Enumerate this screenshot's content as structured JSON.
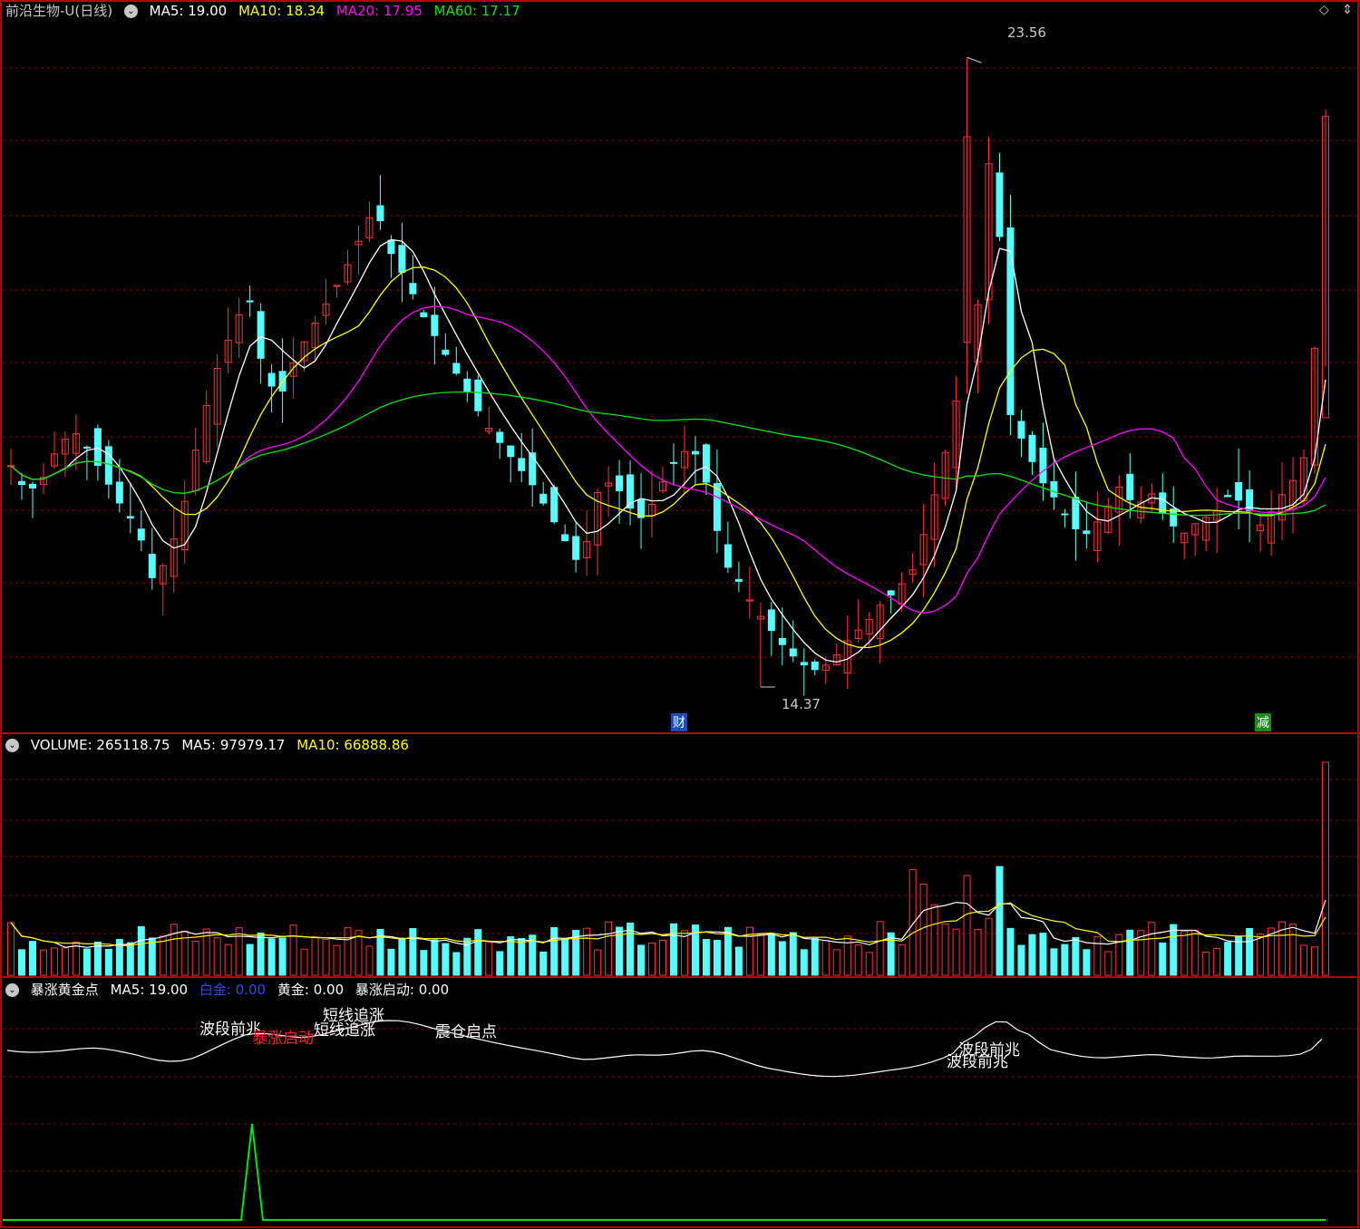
{
  "header": {
    "title": "前沿生物-U(日线)",
    "ma5": "MA5: 19.00",
    "ma10": "MA10: 18.34",
    "ma20": "MA20: 17.95",
    "ma60": "MA60: 17.17",
    "window_icons": [
      "◇",
      "⇕"
    ]
  },
  "volume_header": {
    "volume": "VOLUME: 265118.75",
    "ma5": "MA5: 97979.17",
    "ma10": "MA10: 66888.86"
  },
  "indicator_header": {
    "name": "暴涨黄金点",
    "ma5": "MA5: 19.00",
    "baijin": "白金: 0.00",
    "huangjin": "黄金: 0.00",
    "qidong": "暴涨启动: 0.00"
  },
  "markers": {
    "cai": "财",
    "jian": "减",
    "high_label": "23.56",
    "low_label": "14.37"
  },
  "signals": {
    "s1": "波段前兆",
    "s2": "暴涨启动",
    "s3": "短线追涨",
    "s4": "短线追涨",
    "s5": "震仓启点",
    "s6": "波段前兆",
    "s7": "波段前兆"
  },
  "colors": {
    "up": "#ff3232",
    "down": "#54ffff",
    "ma5": "#ffffff",
    "ma10": "#ffff00",
    "ma20": "#ff00ff",
    "ma60": "#00e600",
    "grid": "#8b0000",
    "panel_border": "#b00000",
    "signal_line": "#00e600"
  },
  "chart_data": [
    {
      "type": "candlestick",
      "title": "前沿生物-U(日线)",
      "ylim": [
        14.0,
        24.0
      ],
      "annotations": [
        {
          "label": "23.56",
          "kind": "period-high"
        },
        {
          "label": "14.37",
          "kind": "period-low"
        }
      ],
      "approx_closes": [
        17.6,
        17.2,
        17.4,
        17.9,
        18.1,
        17.8,
        17.4,
        17.0,
        16.7,
        15.9,
        16.3,
        17.1,
        18.2,
        19.0,
        19.6,
        20.1,
        18.9,
        18.6,
        19.2,
        19.6,
        20.0,
        20.4,
        20.9,
        21.4,
        20.7,
        20.3,
        19.8,
        19.4,
        19.0,
        18.6,
        18.2,
        17.9,
        17.6,
        17.3,
        16.9,
        16.5,
        16.1,
        17.2,
        17.4,
        17.0,
        16.8,
        17.3,
        17.7,
        17.9,
        17.3,
        16.2,
        15.9,
        15.5,
        15.2,
        14.9,
        14.7,
        14.6,
        14.8,
        15.1,
        15.3,
        15.6,
        15.8,
        16.1,
        16.9,
        17.8,
        18.9,
        19.8,
        22.8,
        18.4,
        17.9,
        17.4,
        17.1,
        16.7,
        16.6,
        16.9,
        17.3,
        17.0,
        17.2,
        16.8,
        16.6,
        16.8,
        16.9,
        17.2,
        17.0,
        16.7,
        17.1,
        17.4,
        17.9,
        22.4
      ]
    },
    {
      "type": "bar",
      "title": "VOLUME",
      "ylim": [
        0,
        270000
      ],
      "last_value": 265118.75,
      "ma5_last": 97979.17,
      "ma10_last": 66888.86
    },
    {
      "type": "line",
      "title": "暴涨黄金点",
      "series": [
        {
          "name": "MA5",
          "last": 19.0
        },
        {
          "name": "白金",
          "last": 0.0
        },
        {
          "name": "黄金",
          "last": 0.0
        },
        {
          "name": "暴涨启动",
          "last": 0.0
        }
      ]
    }
  ]
}
